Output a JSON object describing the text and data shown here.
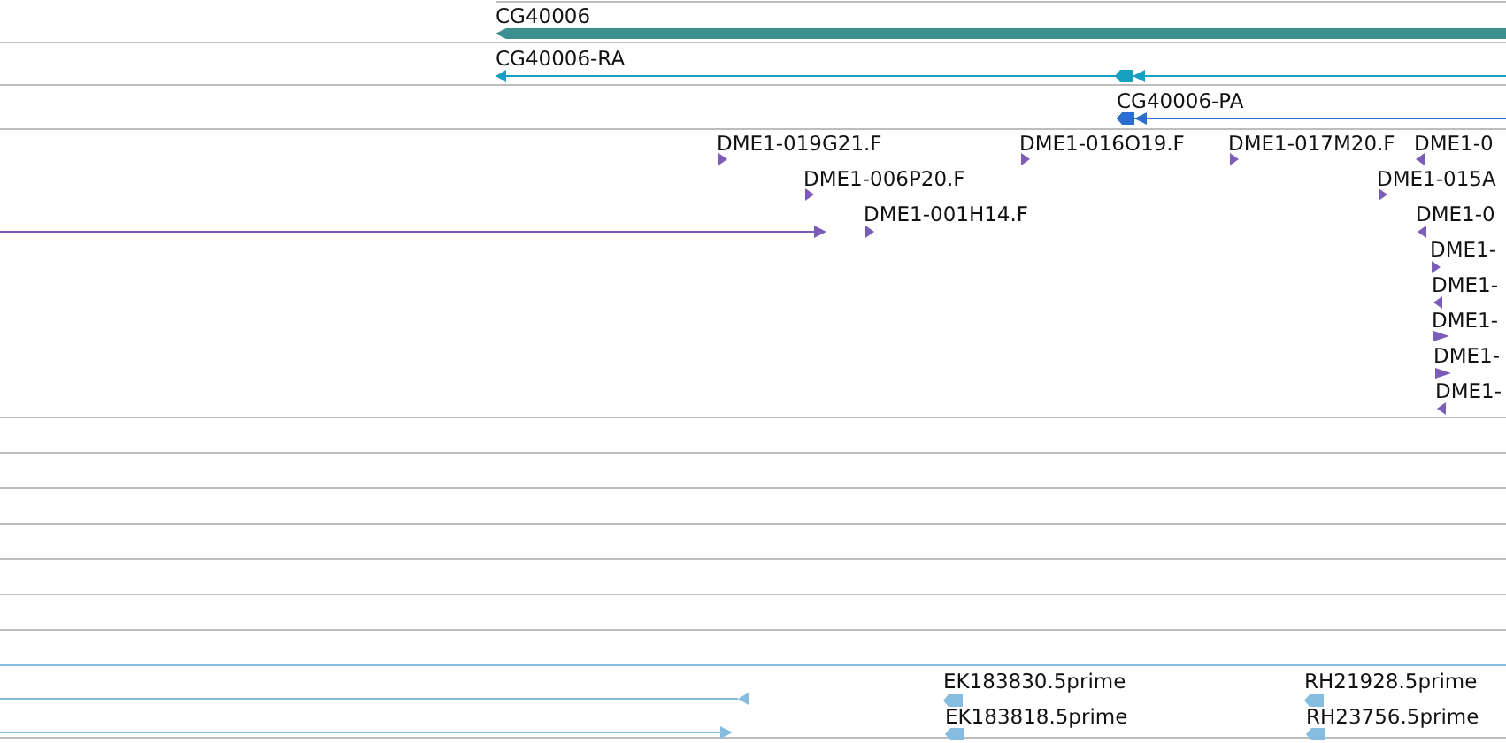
{
  "tracks": [
    {
      "color": "#3d9090",
      "features": [
        {
          "kind": "gene",
          "label": "CG40006",
          "reverse": true
        }
      ]
    },
    {
      "color": "#18a0c0",
      "features": [
        {
          "kind": "transcript",
          "label": "CG40006-RA",
          "reverse": true
        }
      ]
    },
    {
      "color": "#2a6fd0",
      "features": [
        {
          "kind": "transcript",
          "label": "CG40006-PA",
          "reverse": true
        }
      ]
    },
    {
      "color": "#7b5cb8",
      "features": [
        {
          "kind": "read",
          "reverse": false
        },
        {
          "kind": "read",
          "label": "DME1-019G21.F",
          "reverse": false
        },
        {
          "kind": "read",
          "label": "DME1-016O19.F",
          "reverse": false
        },
        {
          "kind": "read",
          "label": "DME1-017M20.F",
          "reverse": false
        },
        {
          "kind": "read",
          "label": "DME1-0",
          "reverse": true
        },
        {
          "kind": "read",
          "label": "DME1-006P20.F",
          "reverse": false
        },
        {
          "kind": "read",
          "label": "DME1-015A",
          "reverse": false
        },
        {
          "kind": "read",
          "label": "DME1-001H14.F",
          "reverse": false
        },
        {
          "kind": "read",
          "label": "DME1-0",
          "reverse": true
        },
        {
          "kind": "read",
          "label": "DME1-",
          "reverse": false
        },
        {
          "kind": "read",
          "label": "DME1-",
          "reverse": true
        },
        {
          "kind": "read",
          "label": "DME1-",
          "reverse": false
        },
        {
          "kind": "read",
          "label": "DME1-",
          "reverse": false
        },
        {
          "kind": "read",
          "label": "DME1-",
          "reverse": true
        }
      ]
    },
    {
      "color": "#86bce0",
      "features": [
        {
          "kind": "read",
          "reverse": true
        },
        {
          "kind": "read",
          "reverse": false
        },
        {
          "kind": "read",
          "label": "EK183830.5prime",
          "reverse": true
        },
        {
          "kind": "read",
          "label": "RH21928.5prime",
          "reverse": true
        },
        {
          "kind": "read",
          "label": "EK183818.5prime",
          "reverse": true
        },
        {
          "kind": "read",
          "label": "RH23756.5prime",
          "reverse": true
        }
      ]
    }
  ]
}
